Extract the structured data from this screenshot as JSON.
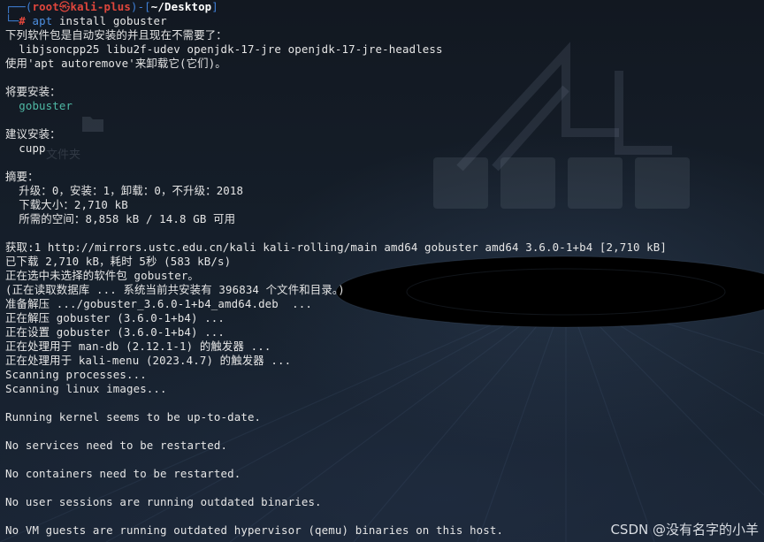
{
  "prompt": {
    "corner_top": "┌──(",
    "user": "root",
    "at": "㉿",
    "host": "kali-plus",
    "sep": ")-[",
    "path": "~/Desktop",
    "close": "]",
    "corner_bottom": "└─",
    "hash": "#",
    "command": "apt",
    "args": " install gobuster"
  },
  "lines": [
    "下列软件包是自动安装的并且现在不需要了：",
    "  libjsoncpp25 libu2f-udev openjdk-17-jre openjdk-17-jre-headless",
    "使用'apt autoremove'来卸载它(它们)。",
    "",
    "将要安装：",
    "  gobuster",
    "",
    "建议安装：",
    "  cupp",
    "",
    "摘要：",
    "  升级：0，安装：1，卸载：0，不升级：2018",
    "  下载大小：2,710 kB",
    "  所需的空间：8,858 kB / 14.8 GB 可用",
    "",
    "获取:1 http://mirrors.ustc.edu.cn/kali kali-rolling/main amd64 gobuster amd64 3.6.0-1+b4 [2,710 kB]",
    "已下载 2,710 kB，耗时 5秒 (583 kB/s)",
    "正在选中未选择的软件包 gobuster。",
    "(正在读取数据库 ... 系统当前共安装有 396834 个文件和目录。)",
    "准备解压 .../gobuster_3.6.0-1+b4_amd64.deb  ...",
    "正在解压 gobuster (3.6.0-1+b4) ...",
    "正在设置 gobuster (3.6.0-1+b4) ...",
    "正在处理用于 man-db (2.12.1-1) 的触发器 ...",
    "正在处理用于 kali-menu (2023.4.7) 的触发器 ...",
    "Scanning processes...",
    "Scanning linux images...",
    "",
    "Running kernel seems to be up-to-date.",
    "",
    "No services need to be restarted.",
    "",
    "No containers need to be restarted.",
    "",
    "No user sessions are running outdated binaries.",
    "",
    "No VM guests are running outdated hypervisor (qemu) binaries on this host."
  ],
  "desktop": {
    "folder_label": "文件夹"
  },
  "watermark": "CSDN @没有名字的小羊",
  "colors": {
    "background": "#141a24",
    "text": "#e6e6e6",
    "prompt_blue": "#3f7fd6",
    "prompt_red": "#e0463c",
    "highlight_green": "#4fb9a5"
  }
}
